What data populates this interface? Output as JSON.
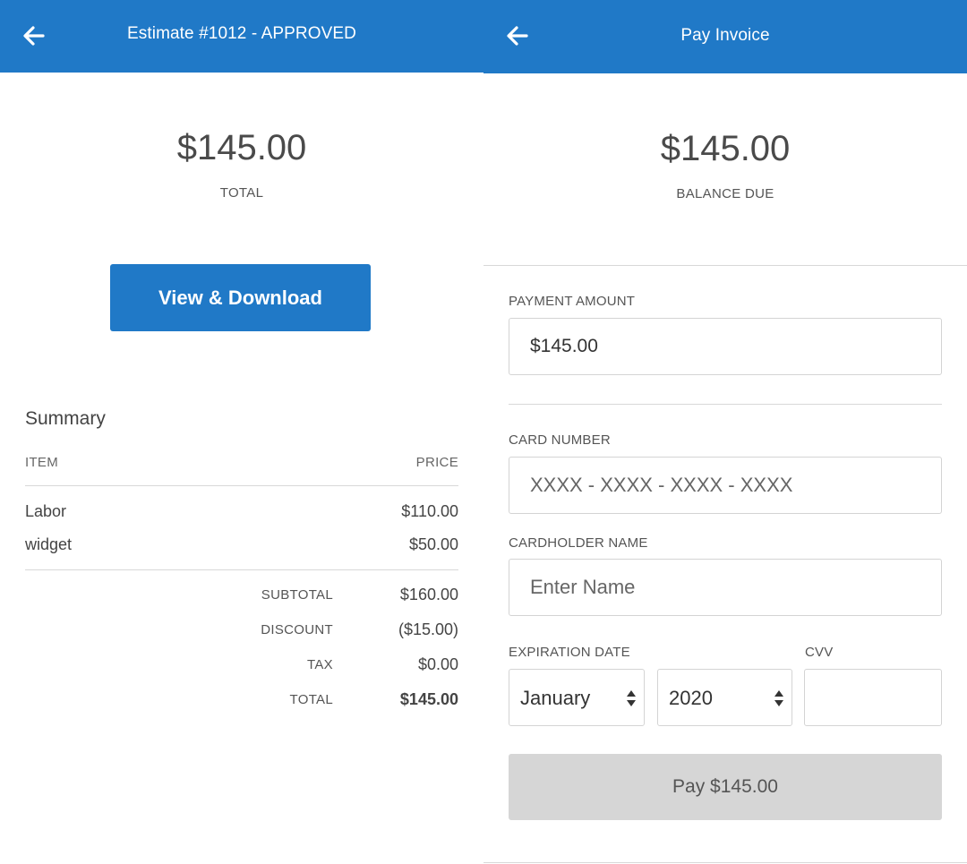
{
  "left": {
    "header": {
      "title": "Estimate #1012 - APPROVED",
      "back_icon": "arrow-left-icon"
    },
    "amount": "$145.00",
    "amount_caption": "TOTAL",
    "view_download_label": "View & Download",
    "summary": {
      "title": "Summary",
      "columns": {
        "item": "ITEM",
        "price": "PRICE"
      },
      "items": [
        {
          "name": "Labor",
          "price": "$110.00"
        },
        {
          "name": "widget",
          "price": "$50.00"
        }
      ],
      "totals": [
        {
          "label": "SUBTOTAL",
          "value": "$160.00"
        },
        {
          "label": "DISCOUNT",
          "value": "($15.00)"
        },
        {
          "label": "TAX",
          "value": "$0.00"
        },
        {
          "label": "TOTAL",
          "value": "$145.00"
        }
      ]
    }
  },
  "right": {
    "header": {
      "title": "Pay Invoice",
      "back_icon": "arrow-left-icon"
    },
    "amount": "$145.00",
    "amount_caption": "BALANCE DUE",
    "payment_amount": {
      "label": "PAYMENT AMOUNT",
      "value": "$145.00"
    },
    "card_number": {
      "label": "CARD NUMBER",
      "placeholder": "XXXX - XXXX - XXXX - XXXX"
    },
    "cardholder_name": {
      "label": "CARDHOLDER NAME",
      "placeholder": "Enter Name"
    },
    "expiration": {
      "label": "EXPIRATION DATE",
      "month": "January",
      "year": "2020"
    },
    "cvv": {
      "label": "CVV",
      "value": ""
    },
    "pay_button_label": "Pay $145.00"
  },
  "colors": {
    "header_bg": "#2079c7",
    "primary_button": "#2079c7",
    "disabled_button": "#d6d6d6"
  }
}
